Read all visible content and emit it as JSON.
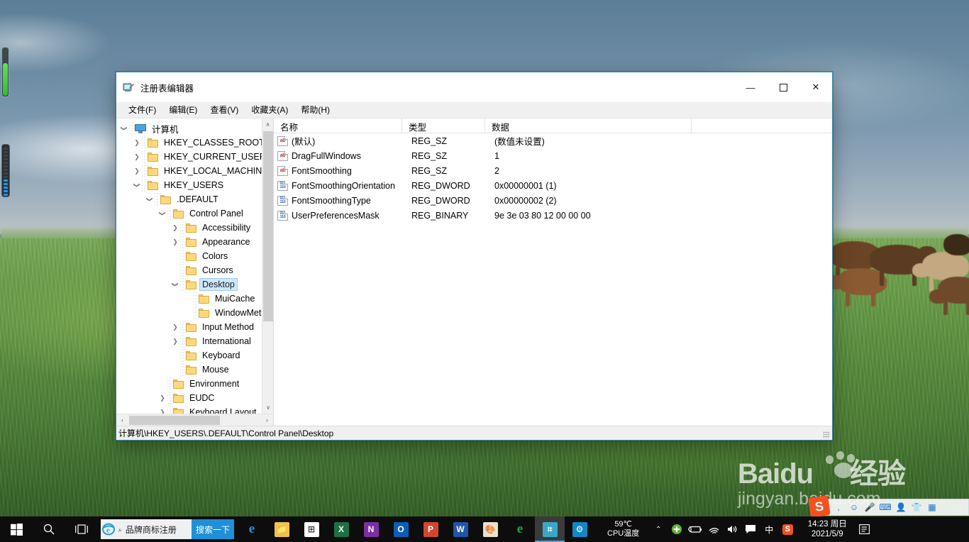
{
  "window": {
    "title": "注册表编辑器",
    "icon": "regedit-icon",
    "buttons": {
      "minimize": "—",
      "maximize": "☐",
      "close": "✕"
    },
    "menu": [
      "文件(F)",
      "编辑(E)",
      "查看(V)",
      "收藏夹(A)",
      "帮助(H)"
    ],
    "statusbar": "计算机\\HKEY_USERS\\.DEFAULT\\Control Panel\\Desktop"
  },
  "tree": {
    "nodes": [
      {
        "label": "计算机",
        "indent": 0,
        "arrow": "down",
        "icon": "monitor",
        "selected": false
      },
      {
        "label": "HKEY_CLASSES_ROOT",
        "indent": 1,
        "arrow": "right",
        "icon": "folder",
        "selected": false
      },
      {
        "label": "HKEY_CURRENT_USER",
        "indent": 1,
        "arrow": "right",
        "icon": "folder",
        "selected": false
      },
      {
        "label": "HKEY_LOCAL_MACHINE",
        "indent": 1,
        "arrow": "right",
        "icon": "folder",
        "selected": false
      },
      {
        "label": "HKEY_USERS",
        "indent": 1,
        "arrow": "down",
        "icon": "folder",
        "selected": false
      },
      {
        "label": ".DEFAULT",
        "indent": 2,
        "arrow": "down",
        "icon": "folder",
        "selected": false
      },
      {
        "label": "Control Panel",
        "indent": 3,
        "arrow": "down",
        "icon": "folder",
        "selected": false
      },
      {
        "label": "Accessibility",
        "indent": 4,
        "arrow": "right",
        "icon": "folder",
        "selected": false
      },
      {
        "label": "Appearance",
        "indent": 4,
        "arrow": "right",
        "icon": "folder",
        "selected": false
      },
      {
        "label": "Colors",
        "indent": 4,
        "arrow": "none",
        "icon": "folder",
        "selected": false
      },
      {
        "label": "Cursors",
        "indent": 4,
        "arrow": "none",
        "icon": "folder",
        "selected": false
      },
      {
        "label": "Desktop",
        "indent": 4,
        "arrow": "down",
        "icon": "folder",
        "selected": true
      },
      {
        "label": "MuiCache",
        "indent": 5,
        "arrow": "none",
        "icon": "folder",
        "selected": false
      },
      {
        "label": "WindowMetrics",
        "indent": 5,
        "arrow": "none",
        "icon": "folder",
        "selected": false
      },
      {
        "label": "Input Method",
        "indent": 4,
        "arrow": "right",
        "icon": "folder",
        "selected": false
      },
      {
        "label": "International",
        "indent": 4,
        "arrow": "right",
        "icon": "folder",
        "selected": false
      },
      {
        "label": "Keyboard",
        "indent": 4,
        "arrow": "none",
        "icon": "folder",
        "selected": false
      },
      {
        "label": "Mouse",
        "indent": 4,
        "arrow": "none",
        "icon": "folder",
        "selected": false
      },
      {
        "label": "Environment",
        "indent": 3,
        "arrow": "none",
        "icon": "folder",
        "selected": false
      },
      {
        "label": "EUDC",
        "indent": 3,
        "arrow": "right",
        "icon": "folder",
        "selected": false
      },
      {
        "label": "Keyboard Layout",
        "indent": 3,
        "arrow": "right",
        "icon": "folder",
        "selected": false
      }
    ],
    "scroll": {
      "up": "∧",
      "down": "∨",
      "left": "‹",
      "right": "›"
    }
  },
  "list": {
    "columns": [
      "名称",
      "类型",
      "数据"
    ],
    "rows": [
      {
        "name": "(默认)",
        "type": "REG_SZ",
        "data": "(数值未设置)",
        "icon": "string-value-icon"
      },
      {
        "name": "DragFullWindows",
        "type": "REG_SZ",
        "data": "1",
        "icon": "string-value-icon"
      },
      {
        "name": "FontSmoothing",
        "type": "REG_SZ",
        "data": "2",
        "icon": "string-value-icon"
      },
      {
        "name": "FontSmoothingOrientation",
        "type": "REG_DWORD",
        "data": "0x00000001 (1)",
        "icon": "binary-value-icon"
      },
      {
        "name": "FontSmoothingType",
        "type": "REG_DWORD",
        "data": "0x00000002 (2)",
        "icon": "binary-value-icon"
      },
      {
        "name": "UserPreferencesMask",
        "type": "REG_BINARY",
        "data": "9e 3e 03 80 12 00 00 00",
        "icon": "binary-value-icon"
      }
    ]
  },
  "taskbar": {
    "start": "start-icon",
    "search": "search-icon",
    "taskview": "task-view-icon",
    "search_widget": {
      "engine_icon": "ie-icon",
      "text": "品牌商标注册",
      "button": "搜索一下"
    },
    "apps": [
      {
        "name": "edge",
        "label": "e",
        "color": "#2d8fd5"
      },
      {
        "name": "explorer",
        "label": "📁",
        "color": "#f5c249"
      },
      {
        "name": "store",
        "label": "⊞",
        "color": "#ffffff"
      },
      {
        "name": "excel",
        "label": "X",
        "color": "#1d7044"
      },
      {
        "name": "onenote",
        "label": "N",
        "color": "#7b2fa0"
      },
      {
        "name": "outlook",
        "label": "O",
        "color": "#0a5fb5"
      },
      {
        "name": "powerpoint",
        "label": "P",
        "color": "#d2462f"
      },
      {
        "name": "word",
        "label": "W",
        "color": "#2155a8"
      },
      {
        "name": "paint",
        "label": "🎨",
        "color": "#e9e0d0"
      },
      {
        "name": "360browser",
        "label": "e",
        "color": "#22a24d"
      },
      {
        "name": "regedit",
        "label": "⌗",
        "color": "#3aa7c9"
      },
      {
        "name": "settings",
        "label": "⚙",
        "color": "#1288c4"
      }
    ],
    "cpu": {
      "temp": "59℃",
      "label": "CPU温度"
    },
    "tray": [
      "∧",
      "shield-icon",
      "battery-icon",
      "wifi-icon",
      "volume-icon",
      "notification-icon",
      "中",
      "sogou-icon"
    ],
    "clock": {
      "time": "14:23  周日",
      "date": "2021/5/9"
    },
    "action_center": "action-center-icon"
  },
  "watermark": {
    "brand": "Baidu",
    "suffix": "经验",
    "url": "jingyan.baidu.com"
  },
  "gadgets": {
    "cpu_meter": "cpu-usage-gadget",
    "memory_meter": "memory-usage-gadget"
  }
}
